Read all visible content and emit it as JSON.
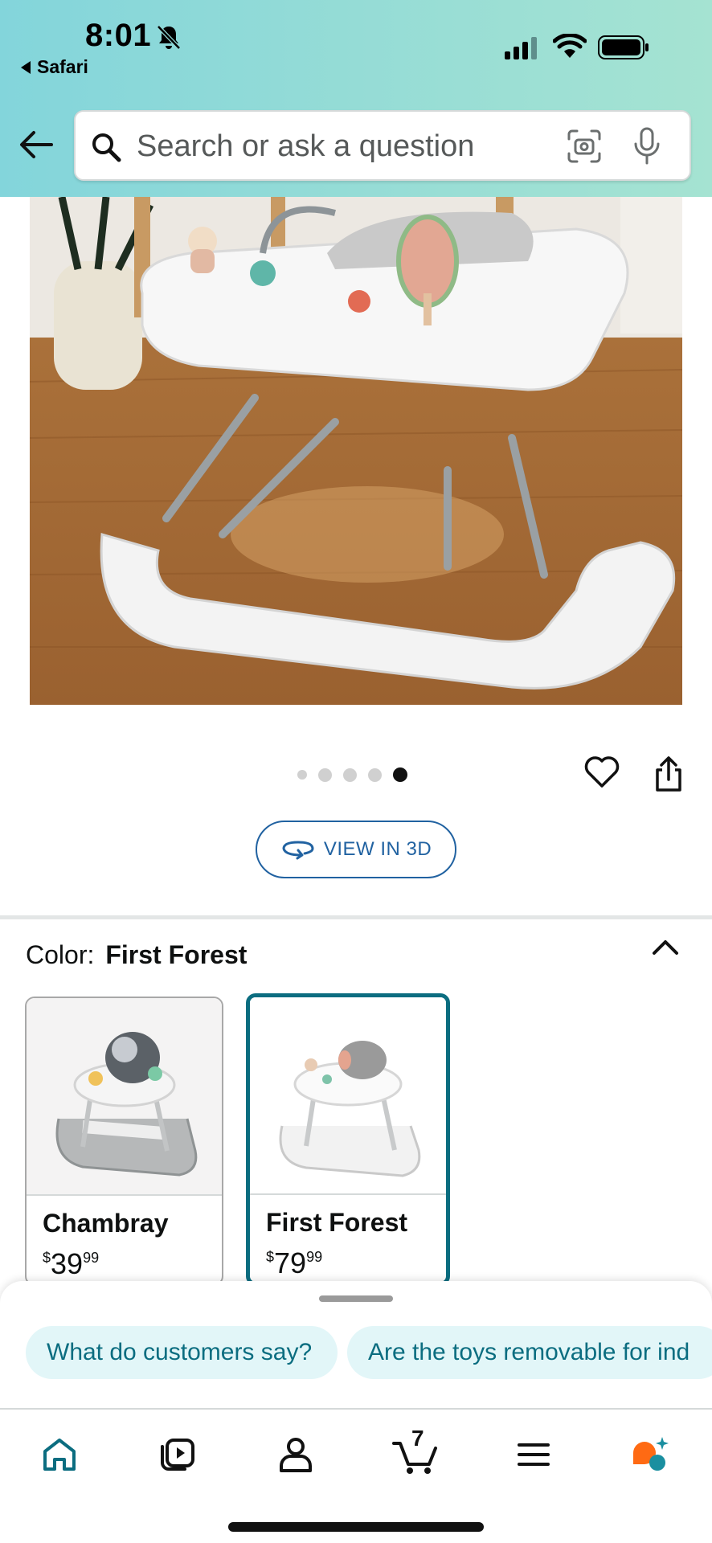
{
  "status_bar": {
    "time": "8:01",
    "back_app": "Safari"
  },
  "search": {
    "placeholder": "Search or ask a question"
  },
  "gallery": {
    "dot_count": 5,
    "active_index": 4,
    "view_3d_label": "VIEW IN 3D"
  },
  "color_selector": {
    "label": "Color:",
    "selected": "First Forest",
    "options": [
      {
        "name": "Chambray",
        "currency": "$",
        "price_whole": "39",
        "price_fraction": "99"
      },
      {
        "name": "First Forest",
        "currency": "$",
        "price_whole": "79",
        "price_fraction": "99"
      }
    ]
  },
  "suggestions": [
    "What do customers say?",
    "Are the toys removable for ind"
  ],
  "tabbar": {
    "cart_count": "7"
  },
  "colors": {
    "header_gradient_start": "#83d5db",
    "header_gradient_end": "#a5e3d2",
    "link_blue": "#2162a1",
    "selected_teal": "#0b6d80",
    "chip_bg": "#e2f6f8"
  }
}
